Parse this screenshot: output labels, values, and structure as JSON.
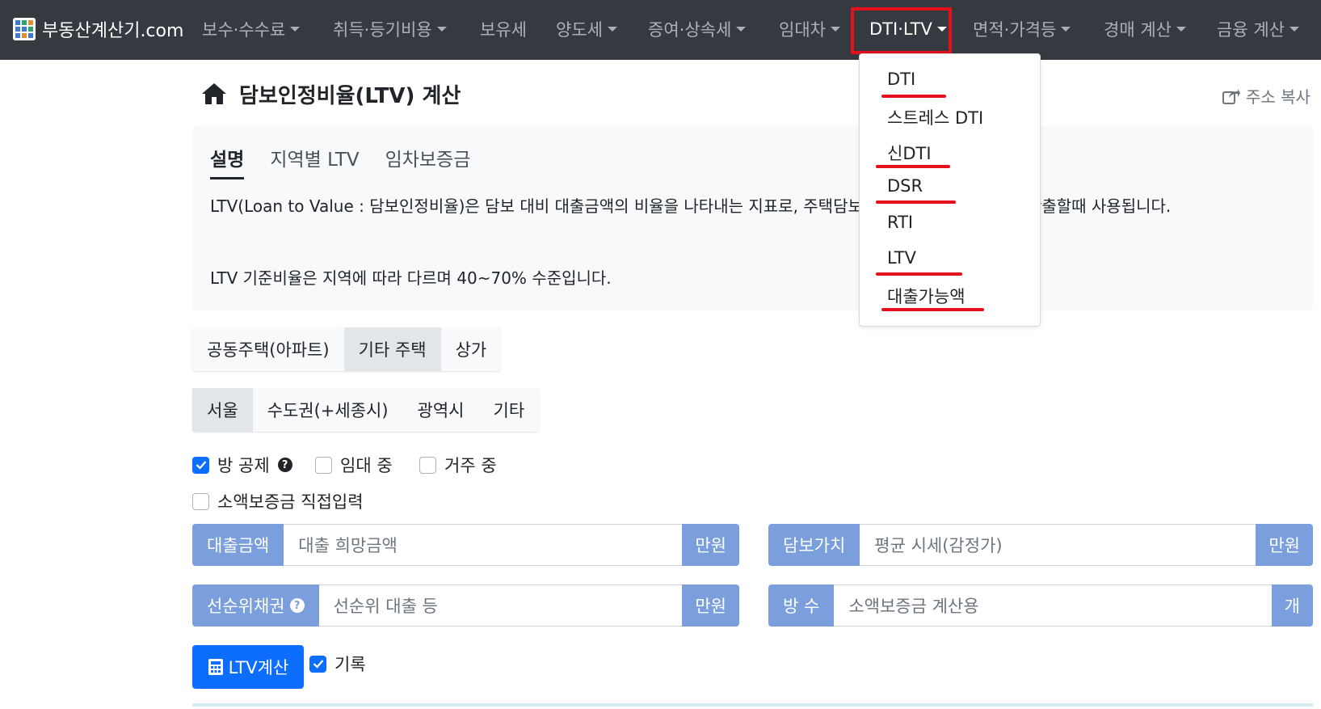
{
  "navbar": {
    "brand": "부동산계산기.com",
    "items": [
      {
        "label": "보수·수수료"
      },
      {
        "label": "취득·등기비용"
      },
      {
        "label": "보유세"
      },
      {
        "label": "양도세"
      },
      {
        "label": "증여·상속세"
      },
      {
        "label": "임대차"
      },
      {
        "label": "DTI·LTV"
      },
      {
        "label": "면적·가격등"
      },
      {
        "label": "경매 계산"
      },
      {
        "label": "금융 계산"
      }
    ],
    "dropdown": [
      "DTI",
      "스트레스 DTI",
      "신DTI",
      "DSR",
      "RTI",
      "LTV",
      "대출가능액"
    ]
  },
  "page": {
    "title": "담보인정비율(LTV) 계산",
    "copy_link": "주소 복사"
  },
  "info": {
    "tabs": [
      "설명",
      "지역별 LTV",
      "임차보증금"
    ],
    "p1": "LTV(Loan to Value : 담보인정비율)은 담보 대비 대출금액의 비율을 나타내는 지표로, 주택담보대출 시 대출가능금액을 산출할때 사용됩니다.",
    "p2": "LTV 기준비율은 지역에 따라 다르며 40~70% 수준입니다."
  },
  "housing_types": [
    "공동주택(아파트)",
    "기타 주택",
    "상가"
  ],
  "regions": [
    "서울",
    "수도권(+세종시)",
    "광역시",
    "기타"
  ],
  "checks": {
    "room_deduction": "방 공제",
    "renting": "임대 중",
    "residing": "거주 중",
    "small_deposit": "소액보증금 직접입력",
    "record": "기록"
  },
  "fields": {
    "loan": {
      "label": "대출금액",
      "placeholder": "대출 희망금액",
      "unit": "만원"
    },
    "collateral": {
      "label": "담보가치",
      "placeholder": "평균 시세(감정가)",
      "unit": "만원"
    },
    "prior": {
      "label": "선순위채권",
      "placeholder": "선순위 대출 등",
      "unit": "만원"
    },
    "rooms": {
      "label": "방 수",
      "placeholder": "소액보증금 계산용",
      "unit": "개"
    }
  },
  "calc_button": "LTV계산",
  "colors": {
    "navbar": "#343a40",
    "highlight_red": "#e4101c",
    "input_label": "#7a9fdc",
    "primary": "#0d6efd"
  }
}
